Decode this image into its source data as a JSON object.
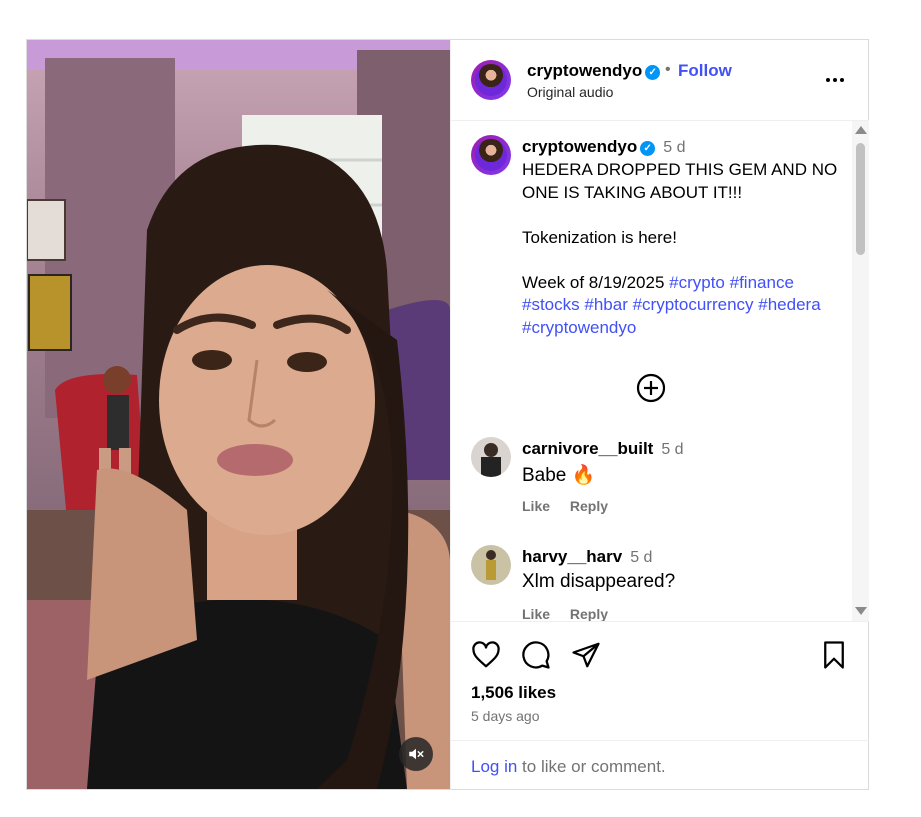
{
  "post": {
    "username": "cryptowendyo",
    "follow_label": "Follow",
    "separator": "•",
    "audio": "Original audio"
  },
  "caption": {
    "username": "cryptowendyo",
    "time": "5 d",
    "lines": [
      "HEDERA DROPPED THIS GEM AND NO",
      "ONE IS TAKING ABOUT IT!!!",
      "",
      "Tokenization is here!",
      "",
      "Week of 8/19/2025"
    ],
    "hashtags_line1": [
      "#crypto",
      "#finance"
    ],
    "hashtags_line2": [
      "#stocks",
      "#hbar",
      "#cryptocurrency",
      "#hedera"
    ],
    "hashtags_line3": [
      "#cryptowendyo"
    ]
  },
  "comments": [
    {
      "username": "carnivore__built",
      "time": "5 d",
      "text": "Babe",
      "emoji": "🔥",
      "like": "Like",
      "reply": "Reply"
    },
    {
      "username": "harvy__harv",
      "time": "5 d",
      "text": "Xlm disappeared?",
      "like": "Like",
      "reply": "Reply"
    }
  ],
  "stats": {
    "likes": "1,506 likes",
    "ago": "5 days ago"
  },
  "footer": {
    "login": "Log in",
    "rest": " to like or comment."
  },
  "icons": {
    "verified": "verified-badge-icon",
    "more": "more-options-icon",
    "add": "add-comment-plus-icon",
    "like": "heart-icon",
    "comment": "comment-bubble-icon",
    "share": "paper-plane-icon",
    "save": "bookmark-icon",
    "mute": "speaker-muted-icon"
  },
  "colors": {
    "link": "#4150f7",
    "verified": "#0095f6",
    "muted": "#737373"
  }
}
